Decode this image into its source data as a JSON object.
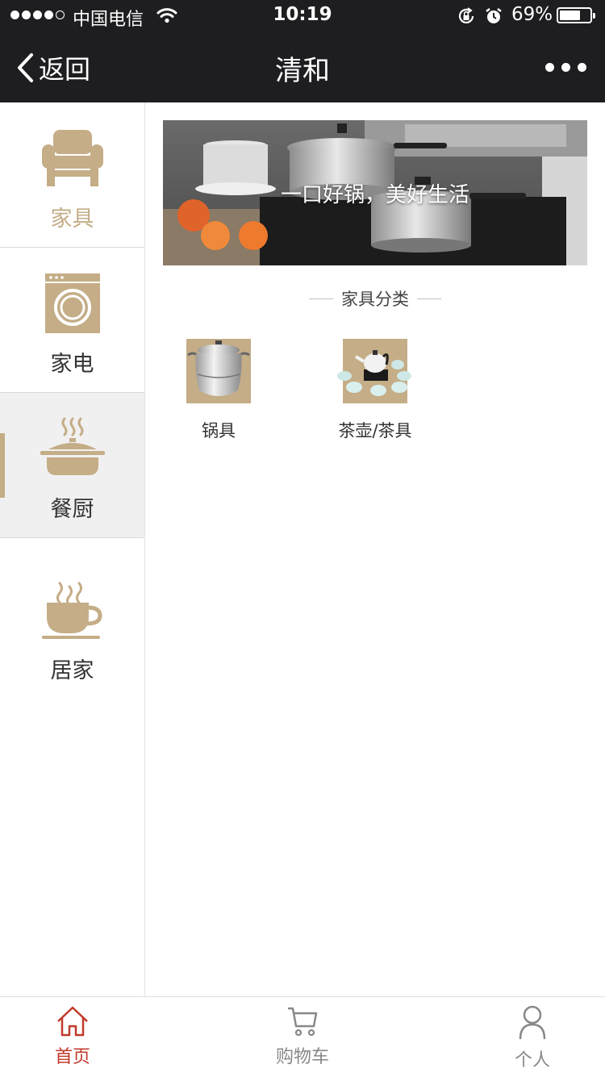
{
  "status_bar": {
    "carrier": "中国电信",
    "time": "10:19",
    "battery_percent_label": "69%",
    "battery_level": 0.69
  },
  "nav": {
    "back_label": "返回",
    "title": "清和"
  },
  "sidebar": {
    "items": [
      {
        "label": "家具",
        "icon": "sofa-icon"
      },
      {
        "label": "家电",
        "icon": "washing-machine-icon"
      },
      {
        "label": "餐厨",
        "icon": "pot-icon"
      },
      {
        "label": "居家",
        "icon": "coffee-cup-icon"
      }
    ],
    "selected_index": 2,
    "highlighted_label_index": 0
  },
  "main": {
    "banner_caption": "一口好锅，美好生活",
    "section_title": "家具分类",
    "categories": [
      {
        "label": "锅具",
        "icon": "stock-pot-image"
      },
      {
        "label": "茶壶/茶具",
        "icon": "tea-set-image"
      }
    ]
  },
  "tab_bar": {
    "tabs": [
      {
        "label": "首页",
        "icon": "home-icon"
      },
      {
        "label": "购物车",
        "icon": "cart-icon"
      },
      {
        "label": "个人",
        "icon": "person-icon"
      }
    ],
    "active_index": 0
  },
  "colors": {
    "header_bg": "#1e1e21",
    "accent_gold": "#c4ad87",
    "active_tab": "#c0392b",
    "inactive_tab": "#888888",
    "sidebar_active_bg": "#f0f0f0"
  }
}
